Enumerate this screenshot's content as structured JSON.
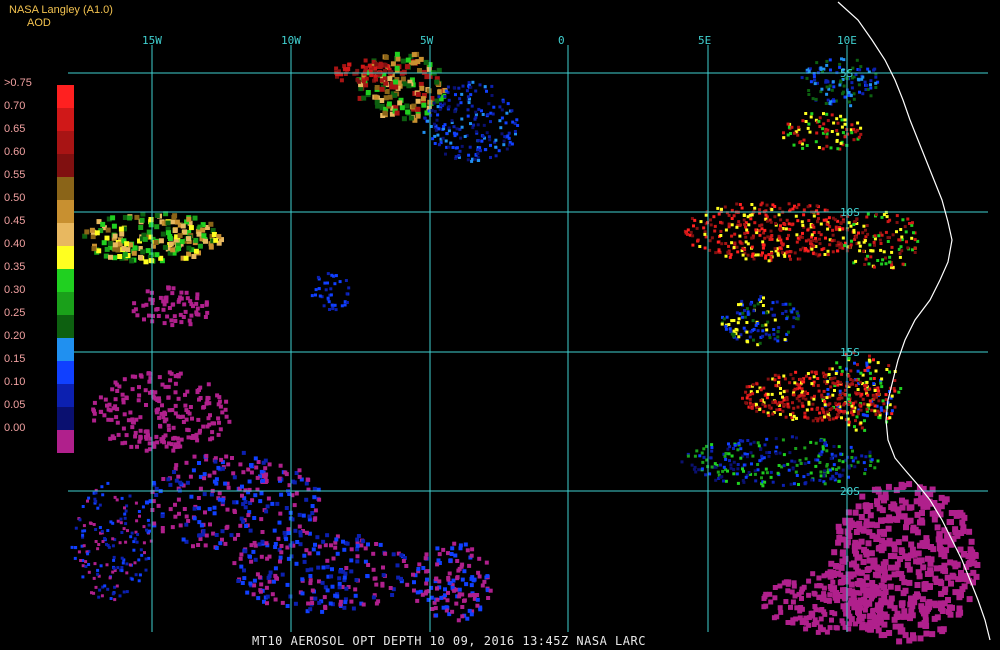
{
  "header": {
    "source": "NASA Langley (A1.0)",
    "product": "AOD"
  },
  "footer": {
    "caption": "MT10  AEROSOL OPT DEPTH   10 09, 2016 13:45Z   NASA LARC"
  },
  "colors": {
    "background": "#000000",
    "grid": "#40d0d0",
    "coastline": "#ffffff",
    "legend_text": "#f0a0a0",
    "header_text": "#f2c24f"
  },
  "legend": {
    "labels": [
      ">0.75",
      "0.70",
      "0.65",
      "0.60",
      "0.55",
      "0.50",
      "0.45",
      "0.40",
      "0.35",
      "0.30",
      "0.25",
      "0.20",
      "0.15",
      "0.10",
      "0.05",
      "0.00"
    ],
    "colors": [
      "#ff2020",
      "#d01818",
      "#a81414",
      "#801010",
      "#8a6418",
      "#c89030",
      "#e8b860",
      "#ffff20",
      "#20d020",
      "#1aa01a",
      "#0d6010",
      "#2090f0",
      "#1040ff",
      "#0c20b0",
      "#0a1070",
      "#b0208c"
    ]
  },
  "grid": {
    "lon_labels": [
      "15W",
      "10W",
      "5W",
      "0",
      "5E",
      "10E"
    ],
    "lat_labels": [
      "5S",
      "10S",
      "15S",
      "20S"
    ]
  }
}
